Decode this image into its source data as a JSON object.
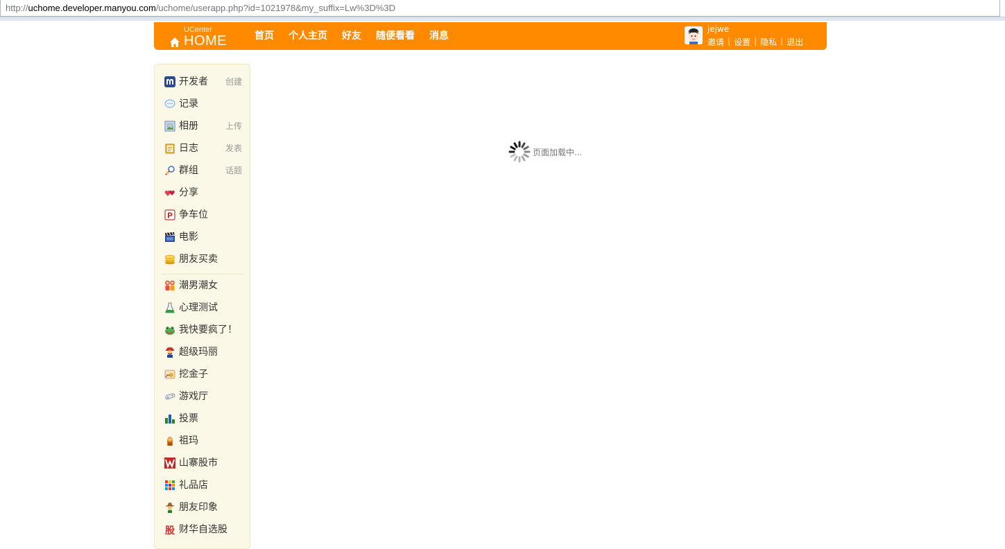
{
  "browser": {
    "url_scheme": "http://",
    "url_host": "uchome.developer.manyou.com",
    "url_path": "/uchome/userapp.php?id=1021978&my_suffix=Lw%3D%3D"
  },
  "header": {
    "logo_small": "UCenter",
    "logo_big": "HOME",
    "nav": [
      "首页",
      "个人主页",
      "好友",
      "随便看看",
      "消息"
    ],
    "username": "jejwe",
    "user_links": [
      "邀请",
      "设置",
      "隐私",
      "退出"
    ],
    "accent_color": "#ff8a00"
  },
  "sidebar": {
    "apps": [
      {
        "label": "开发者",
        "action": "创建",
        "icon": "manyou-icon"
      },
      {
        "label": "记录",
        "action": "",
        "icon": "speech-bubble-icon"
      },
      {
        "label": "相册",
        "action": "上传",
        "icon": "photo-album-icon"
      },
      {
        "label": "日志",
        "action": "发表",
        "icon": "notepad-icon"
      },
      {
        "label": "群组",
        "action": "话题",
        "icon": "group-icon"
      },
      {
        "label": "分享",
        "action": "",
        "icon": "hearts-icon"
      },
      {
        "label": "争车位",
        "action": "",
        "icon": "parking-icon"
      },
      {
        "label": "电影",
        "action": "",
        "icon": "clapperboard-icon"
      },
      {
        "label": "朋友买卖",
        "action": "",
        "icon": "coins-icon"
      }
    ],
    "games": [
      {
        "label": "潮男潮女",
        "icon": "couple-icon"
      },
      {
        "label": "心理测试",
        "icon": "flask-icon"
      },
      {
        "label": "我快要疯了！",
        "icon": "frog-icon"
      },
      {
        "label": "超级玛丽",
        "icon": "mario-icon"
      },
      {
        "label": "挖金子",
        "icon": "gold-digger-icon"
      },
      {
        "label": "游戏厅",
        "icon": "gamepad-icon"
      },
      {
        "label": "投票",
        "icon": "bar-chart-icon"
      },
      {
        "label": "祖玛",
        "icon": "zuma-icon"
      },
      {
        "label": "山寨股市",
        "icon": "stock-w-icon"
      },
      {
        "label": "礼品店",
        "icon": "gift-grid-icon"
      },
      {
        "label": "朋友印象",
        "icon": "cowboy-icon"
      },
      {
        "label": "财华自选股",
        "icon": "stock-gu-icon"
      }
    ]
  },
  "main": {
    "loading_text": "页面加载中..."
  }
}
